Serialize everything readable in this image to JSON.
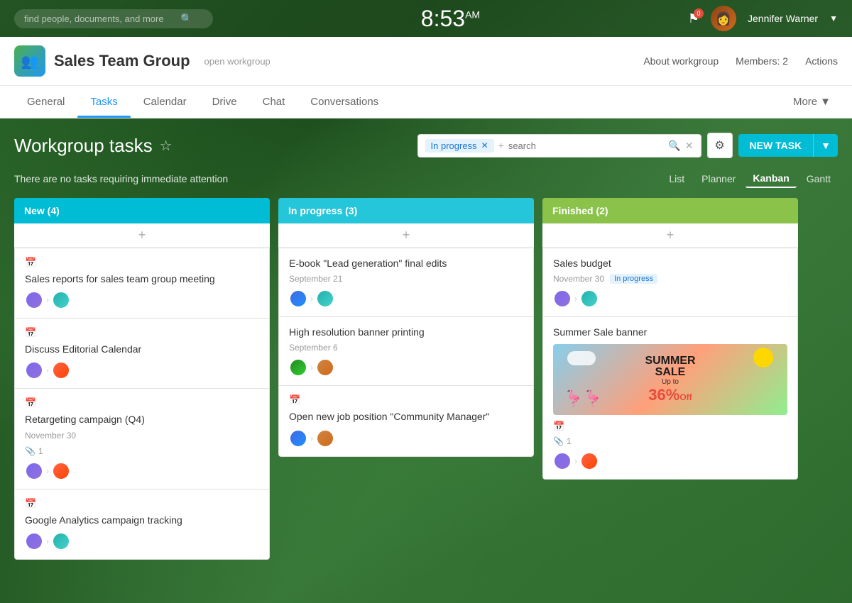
{
  "topbar": {
    "search_placeholder": "find people, documents, and more",
    "time": "8:53",
    "am_pm": "AM",
    "flag_count": "0",
    "user_name": "Jennifer Warner"
  },
  "workgroup": {
    "title": "Sales Team Group",
    "subtitle": "open workgroup",
    "about_label": "About workgroup",
    "members_label": "Members: 2",
    "actions_label": "Actions"
  },
  "tabs": {
    "items": [
      {
        "label": "General",
        "active": false
      },
      {
        "label": "Tasks",
        "active": true
      },
      {
        "label": "Calendar",
        "active": false
      },
      {
        "label": "Drive",
        "active": false
      },
      {
        "label": "Chat",
        "active": false
      },
      {
        "label": "Conversations",
        "active": false
      }
    ],
    "more_label": "More"
  },
  "page": {
    "title": "Workgroup tasks",
    "filter_tag": "In progress",
    "search_placeholder": "search",
    "attention_text": "There are no tasks requiring immediate attention",
    "new_task_label": "NEW TASK"
  },
  "views": {
    "options": [
      "List",
      "Planner",
      "Kanban",
      "Gantt"
    ],
    "active": "Kanban"
  },
  "columns": [
    {
      "id": "new",
      "label": "New (4)",
      "color": "new-col",
      "cards": [
        {
          "title": "Sales reports for sales team group meeting",
          "date": "",
          "avatars": [
            "a1",
            "a2"
          ],
          "has_calendar": true,
          "attachments": null,
          "badge": null,
          "image": null
        },
        {
          "title": "Discuss Editorial Calendar",
          "date": "",
          "avatars": [
            "a1",
            "a3"
          ],
          "has_calendar": true,
          "attachments": null,
          "badge": null,
          "image": null
        },
        {
          "title": "Retargeting campaign (Q4)",
          "date": "November 30",
          "avatars": [
            "a1",
            "a3"
          ],
          "has_calendar": true,
          "attachments": "1",
          "badge": null,
          "image": null
        },
        {
          "title": "Google Analytics campaign tracking",
          "date": "",
          "avatars": [
            "a1",
            "a2"
          ],
          "has_calendar": true,
          "attachments": null,
          "badge": null,
          "image": null
        }
      ]
    },
    {
      "id": "progress",
      "label": "In progress (3)",
      "color": "progress-col",
      "cards": [
        {
          "title": "E-book \"Lead generation\" final edits",
          "date": "September 21",
          "avatars": [
            "a4",
            "a2"
          ],
          "has_calendar": false,
          "attachments": null,
          "badge": null,
          "image": null
        },
        {
          "title": "High resolution banner printing",
          "date": "September 6",
          "avatars": [
            "a5",
            "a6"
          ],
          "has_calendar": false,
          "attachments": null,
          "badge": null,
          "image": null
        },
        {
          "title": "Open new job position \"Community Manager\"",
          "date": "",
          "avatars": [
            "a4",
            "a6"
          ],
          "has_calendar": true,
          "attachments": null,
          "badge": null,
          "image": null
        }
      ]
    },
    {
      "id": "finished",
      "label": "Finished (2)",
      "color": "finished-col",
      "cards": [
        {
          "title": "Sales budget",
          "date": "November 30",
          "avatars": [
            "a1",
            "a2"
          ],
          "has_calendar": false,
          "attachments": null,
          "badge": "In progress",
          "image": null
        },
        {
          "title": "Summer Sale banner",
          "date": "",
          "avatars": [
            "a1",
            "a3"
          ],
          "has_calendar": true,
          "attachments": "1",
          "badge": null,
          "image": "summer_sale"
        }
      ]
    }
  ]
}
